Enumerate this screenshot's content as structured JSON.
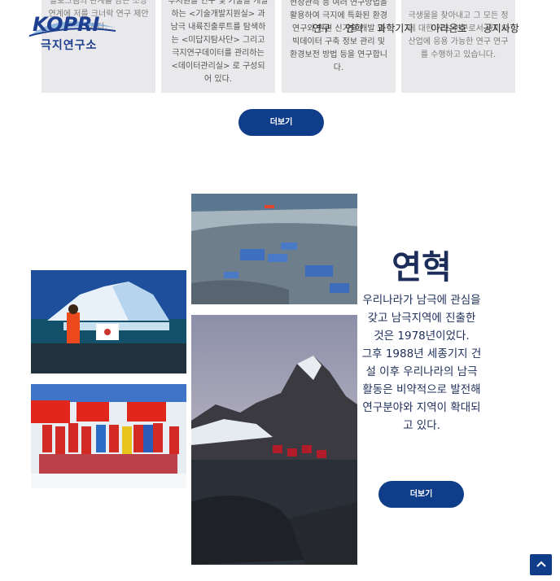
{
  "header": {
    "logo_text": "KOPRI",
    "logo_subtext": "극지연구소",
    "nav": [
      "연구",
      "연혁",
      "과학기지",
      "아라온호",
      "공지사항"
    ]
  },
  "cards": [
    {
      "text": "플로그램의 관계를 담은 소망연계에 저를 크너락 연구 제안시다."
    },
    {
      "text": "부지원을 연구 및 기술을 개발하는 <기술개발지원실> 과 남극 내륙진출루트를 탐색하는 <미답지탐사단> 그리고 극지연구데이터를 관리하는 <데이터관리실> 로 구성되어 있다."
    },
    {
      "text": "현장관측 등 여러 연구방법을 활용하여 극지에 특화된 환경 연구와 관련 신기술 개발 및 빅데이터 구축 정보 관리 및 환경보전 방법 등을 연구합니다."
    },
    {
      "text": "극생물을 찾아내고 그 모든 정에 대한 기초 연구로서 바이오 산업에 응용 가능한 연구 연구를 수행하고 있습니다."
    }
  ],
  "more_button_1": "더보기",
  "history": {
    "title": "연혁",
    "p1": "우리나라가 남극에 관심을 갖고 남극지역에 진출한 것은 1978년이었다.",
    "p2": "그후 1988년 세종기지 건설 이후 우리나라의 남극활동은 비약적으로 발전해 연구분야와 지역이 확대되고 있다.",
    "more_button": "더보기"
  },
  "colors": {
    "primary": "#0f3d8a",
    "heading": "#1c2d5a",
    "card_bg": "#e9e9eb"
  },
  "icons": {
    "scroll_top": "chevron-up-icon"
  }
}
